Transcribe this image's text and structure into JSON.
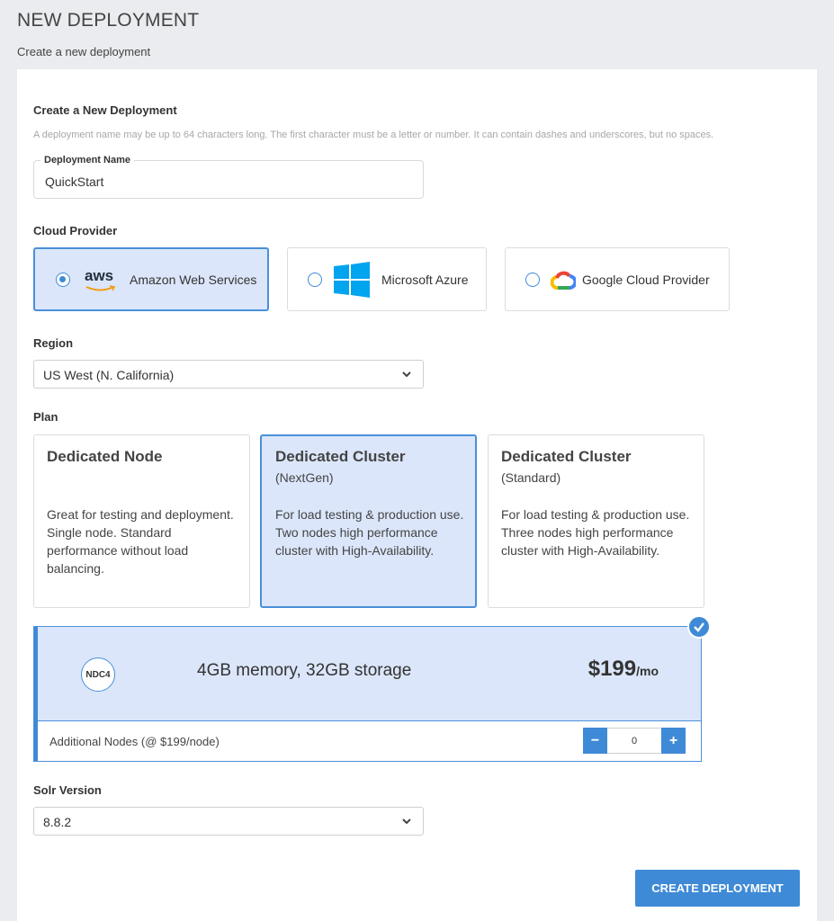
{
  "header": {
    "title": "NEW DEPLOYMENT",
    "subtitle": "Create a new deployment"
  },
  "form": {
    "heading": "Create a New Deployment",
    "hint": "A deployment name may be up to 64 characters long. The first character must be a letter or number. It can contain dashes and underscores, but no spaces.",
    "name_label": "Deployment Name",
    "name_value": "QuickStart",
    "cloud_label": "Cloud Provider",
    "providers": [
      {
        "label": "Amazon Web Services",
        "logo_text": "aws",
        "icon": "aws-logo-icon",
        "selected": true
      },
      {
        "label": "Microsoft Azure",
        "icon": "windows-logo-icon",
        "selected": false
      },
      {
        "label": "Google Cloud Provider",
        "icon": "google-cloud-logo-icon",
        "selected": false
      }
    ],
    "region_label": "Region",
    "region_value": "US West (N. California)",
    "plan_label": "Plan",
    "plans": [
      {
        "title": "Dedicated Node",
        "subtitle": "",
        "description": "Great for testing and deployment. Single node. Standard performance without load balancing.",
        "selected": false
      },
      {
        "title": "Dedicated Cluster",
        "subtitle": "(NextGen)",
        "description": "For load testing & production use. Two nodes high performance cluster with High-Availability.",
        "selected": true
      },
      {
        "title": "Dedicated Cluster",
        "subtitle": "(Standard)",
        "description": "For load testing & production use. Three nodes high performance cluster with High-Availability.",
        "selected": false
      }
    ],
    "tier": {
      "badge": "NDC4",
      "description": "4GB memory, 32GB storage",
      "price": "$199",
      "per": "/mo",
      "additional_label": "Additional Nodes (@ $199/node)",
      "minus": "−",
      "plus": "+",
      "count": "0"
    },
    "solr_label": "Solr Version",
    "solr_value": "8.8.2",
    "submit_label": "CREATE DEPLOYMENT"
  },
  "colors": {
    "accent": "#3f8ad6",
    "selected_bg": "#dbe6fa",
    "page_bg": "#ebecef"
  }
}
